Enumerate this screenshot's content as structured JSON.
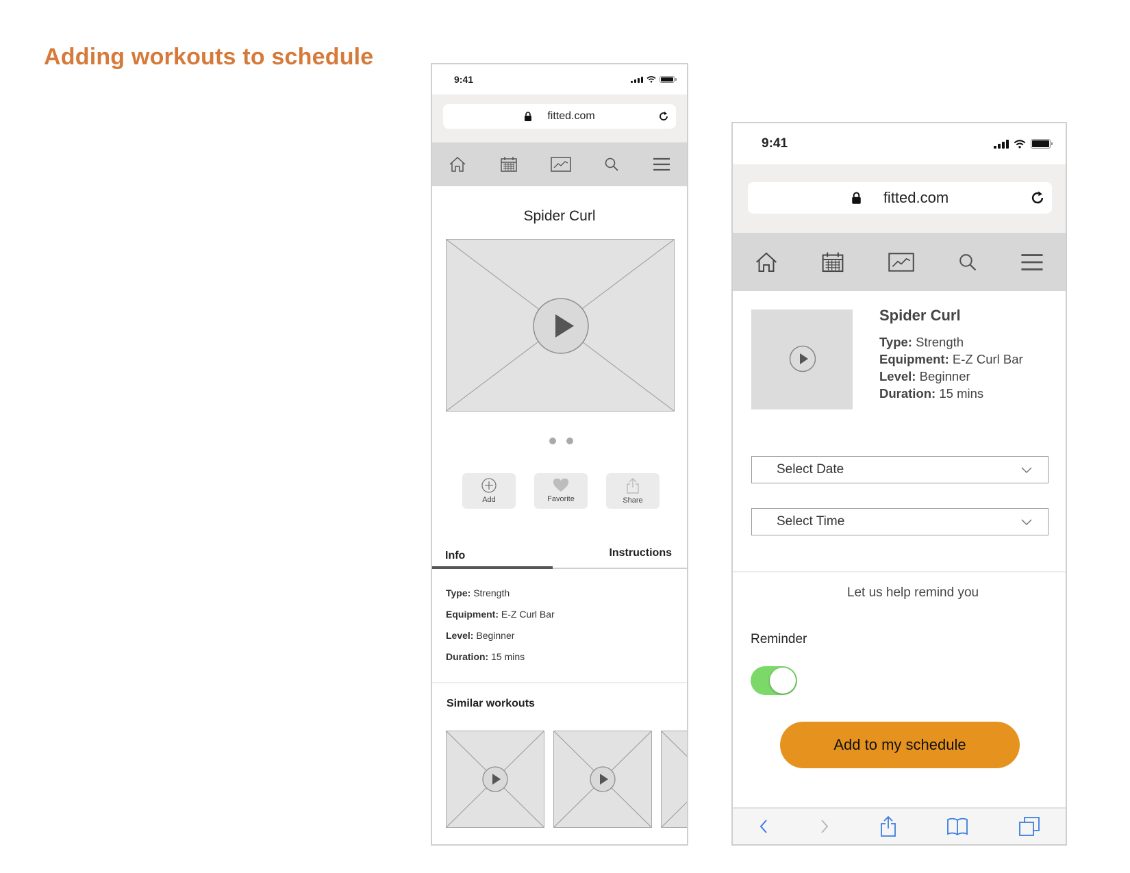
{
  "page": {
    "title": "Adding workouts to schedule"
  },
  "phone1": {
    "status": {
      "time": "9:41"
    },
    "url": "fitted.com",
    "nav": [
      "home-icon",
      "calendar-icon",
      "chart-icon",
      "search-icon",
      "menu-icon"
    ],
    "workout_title": "Spider Curl",
    "carousel_dots": 2,
    "actions": [
      {
        "label": "Add",
        "icon": "plus-circle-icon"
      },
      {
        "label": "Favorite",
        "icon": "heart-icon"
      },
      {
        "label": "Share",
        "icon": "share-icon"
      }
    ],
    "tabs": {
      "info": "Info",
      "instructions": "Instructions"
    },
    "details": {
      "type_label": "Type:",
      "type": "Strength",
      "equipment_label": "Equipment:",
      "equipment": "E-Z Curl Bar",
      "level_label": "Level:",
      "level": "Beginner",
      "duration_label": "Duration:",
      "duration": "15 mins"
    },
    "similar_heading": "Similar workouts"
  },
  "phone2": {
    "status": {
      "time": "9:41"
    },
    "url": "fitted.com",
    "nav": [
      "home-icon",
      "calendar-icon",
      "chart-icon",
      "search-icon",
      "menu-icon"
    ],
    "workout_title": "Spider Curl",
    "details": {
      "type_label": "Type:",
      "type": "Strength",
      "equipment_label": "Equipment:",
      "equipment": "E-Z Curl Bar",
      "level_label": "Level:",
      "level": "Beginner",
      "duration_label": "Duration:",
      "duration": "15 mins"
    },
    "select_date": "Select Date",
    "select_time": "Select Time",
    "remind_text": "Let us help remind you",
    "reminder_label": "Reminder",
    "reminder_on": true,
    "cta": "Add to my schedule",
    "bottom_icons": [
      "back-icon",
      "forward-icon",
      "share-icon",
      "bookmarks-icon",
      "tabs-icon"
    ]
  },
  "colors": {
    "title_accent": "#d67a3a",
    "cta": "#e6921f",
    "toggle_on": "#7dd86a",
    "safari_blue": "#3b7de0"
  }
}
